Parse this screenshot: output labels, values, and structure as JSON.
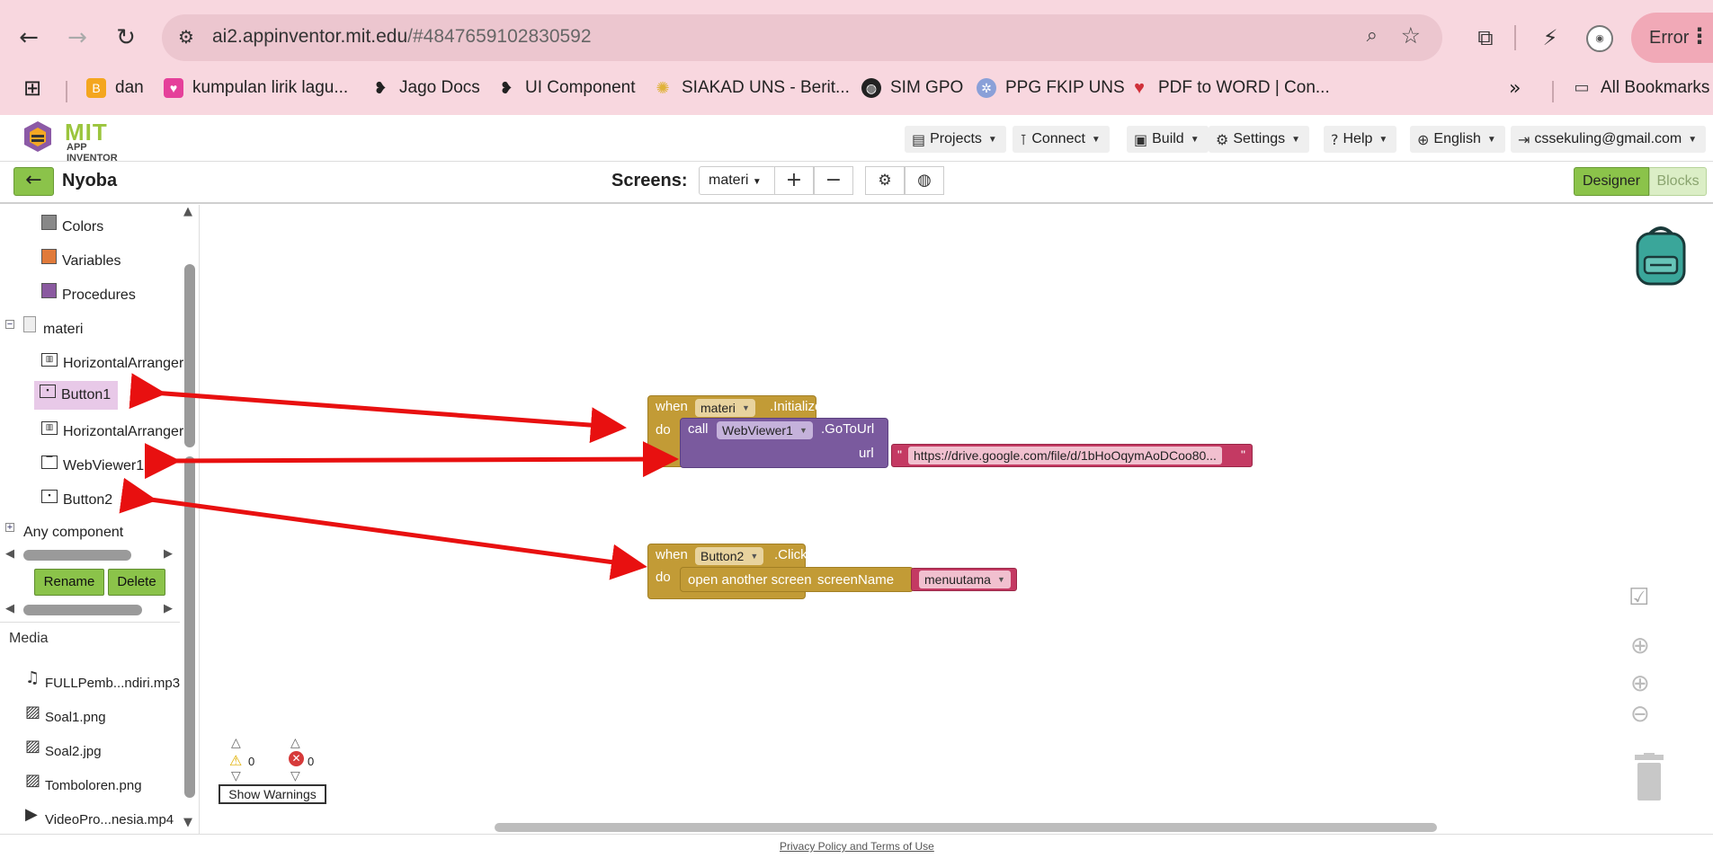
{
  "browser": {
    "url_host": "ai2.appinventor.mit.edu",
    "url_path": "/#4847659102830592",
    "error_label": "Error",
    "bookmarks": [
      {
        "label": "dan",
        "color": "#f4a61f"
      },
      {
        "label": "kumpulan lirik lagu...",
        "color": "#e5409a"
      },
      {
        "label": "Jago Docs",
        "color": "#222222"
      },
      {
        "label": "UI Component",
        "color": "#222222"
      },
      {
        "label": "SIAKAD UNS - Berit...",
        "color": "#e0b23a"
      },
      {
        "label": "SIM GPO",
        "color": "#222222"
      },
      {
        "label": "PPG FKIP UNS",
        "color": "#8aa0d8"
      },
      {
        "label": "PDF to WORD | Con...",
        "color": "#d0303a"
      }
    ],
    "all_bookmarks": "All Bookmarks"
  },
  "header": {
    "logo_mit": "MIT",
    "logo_sub": "APP INVENTOR",
    "menus": {
      "projects": "Projects",
      "connect": "Connect",
      "build": "Build",
      "settings": "Settings",
      "help": "Help",
      "language": "English",
      "account": "cssekuling@gmail.com"
    }
  },
  "project": {
    "name": "Nyoba",
    "screens_label": "Screens:",
    "current_screen": "materi",
    "designer": "Designer",
    "blocks": "Blocks"
  },
  "tree": {
    "builtins": [
      "Colors",
      "Variables",
      "Procedures"
    ],
    "builtin_colors": [
      "#888888",
      "#e07a3a",
      "#8a5aa0"
    ],
    "screen": "materi",
    "components": [
      "HorizontalArranger",
      "Button1",
      "HorizontalArranger",
      "WebViewer1",
      "Button2"
    ],
    "any_component": "Any component",
    "rename": "Rename",
    "delete": "Delete"
  },
  "media": {
    "title": "Media",
    "items": [
      "FULLPemb...ndiri.mp3",
      "Soal1.png",
      "Soal2.jpg",
      "Tomboloren.png",
      "VideoPro...nesia.mp4"
    ]
  },
  "blocks": {
    "b1_when": "when",
    "b1_screen": "materi",
    "b1_event": ".Initialize",
    "b1_do": "do",
    "b1_call": "call",
    "b1_component": "WebViewer1",
    "b1_method": ".GoToUrl",
    "b1_url": "url",
    "b1_value": "https://drive.google.com/file/d/1bHoOqymAoDCoo80...",
    "b2_when": "when",
    "b2_component": "Button2",
    "b2_event": ".Click",
    "b2_do": "do",
    "b2_action": "open another screen",
    "b2_param": "screenName",
    "b2_value": "menuutama"
  },
  "warnings": {
    "warn_count": "0",
    "error_count": "0",
    "button": "Show Warnings"
  },
  "footer": {
    "link": "Privacy Policy and Terms of Use"
  },
  "colors": {
    "accent_green": "#8bc34a",
    "event_gold": "#c29b36",
    "method_purple": "#7a5a9e",
    "text_pink": "#c43a63",
    "annotation_red": "#e81010"
  }
}
